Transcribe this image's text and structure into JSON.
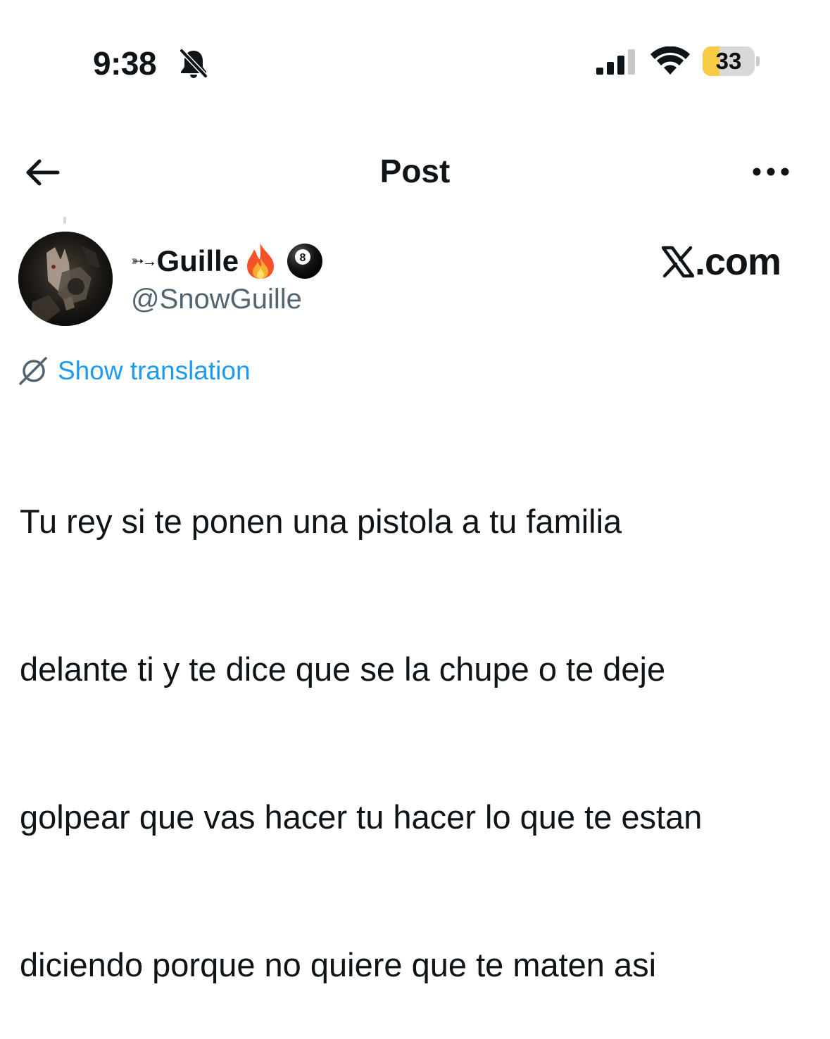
{
  "status_bar": {
    "time": "9:38",
    "battery_level": "33",
    "battery_fraction": 0.33,
    "icons": [
      "bell-off-icon",
      "cellular-signal-icon",
      "wifi-icon",
      "battery-icon"
    ]
  },
  "header": {
    "title": "Post",
    "back_icon": "arrow-left-icon",
    "more_icon": "more-horizontal-icon"
  },
  "author": {
    "display_name": "Guille",
    "name_prefix": "➳→",
    "name_emoji": [
      "fire-icon",
      "billiard-8-ball-icon"
    ],
    "handle": "@SnowGuille"
  },
  "watermark": {
    "text": ".com",
    "logo": "x-logo-icon"
  },
  "translation": {
    "label": "Show translation",
    "icon": "globe-translate-icon"
  },
  "post": {
    "lines": [
      "Tu rey si te ponen una pistola a tu familia",
      "delante ti y te dice que se la chupe o te deje",
      "golpear que vas hacer tu hacer lo que te estan",
      "diciendo porque no quiere que te maten asi"
    ]
  },
  "colors": {
    "accent": "#1d9bf0",
    "text": "#0f1419",
    "secondary_text": "#536471",
    "battery_fill": "#f6cb45"
  }
}
